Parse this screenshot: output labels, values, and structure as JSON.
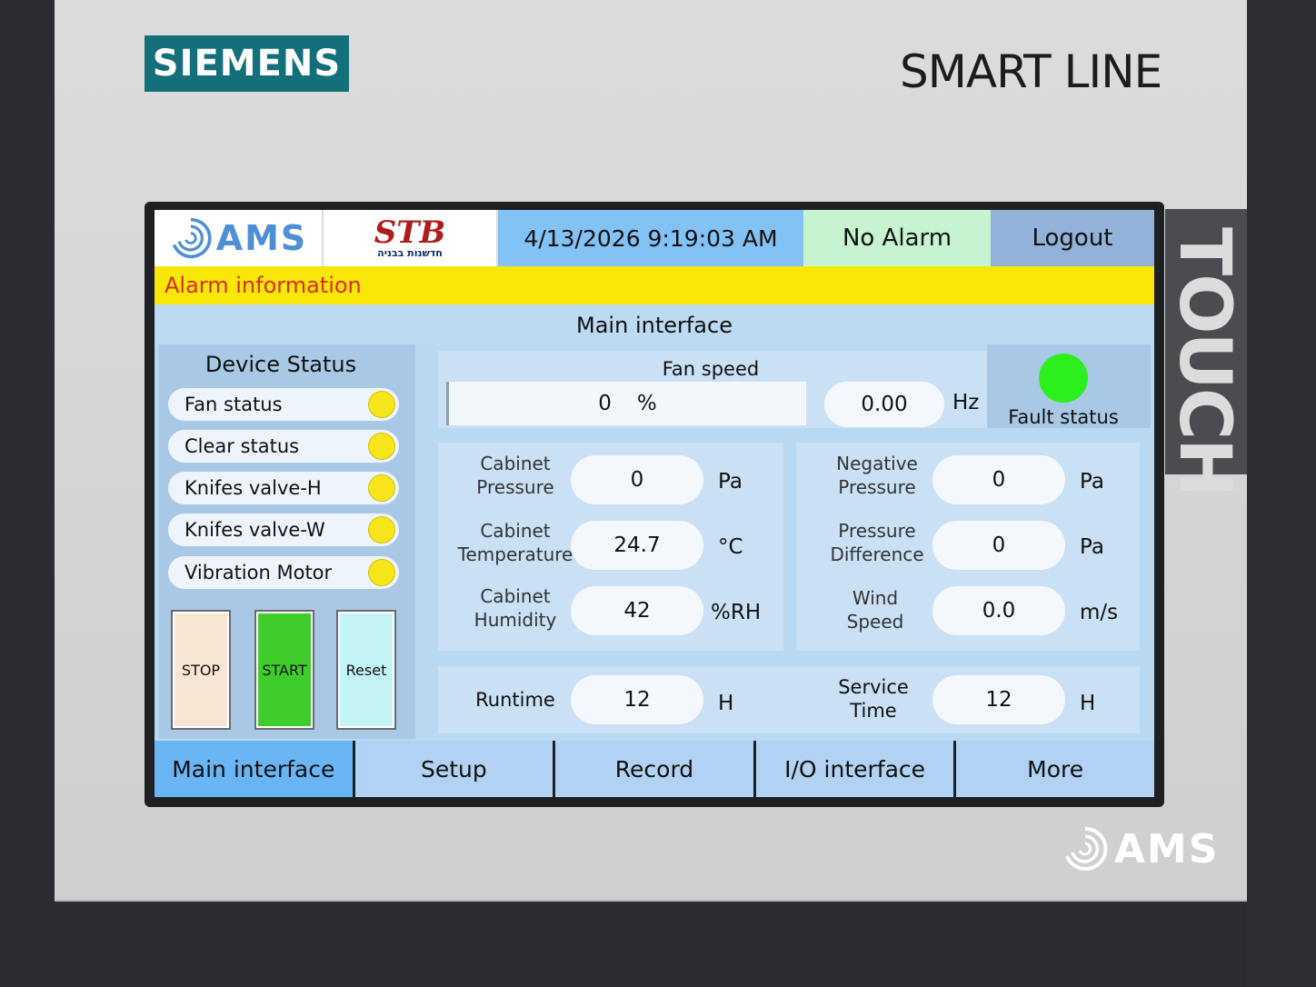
{
  "device": {
    "brand": "SIEMENS",
    "model": "SMART LINE",
    "side_label": "TOUCH",
    "bezel_logo": "AMS"
  },
  "header": {
    "ams_logo": "AMS",
    "stb_logo": "STB",
    "stb_subtitle": "חדשנות בבניה",
    "datetime": "4/13/2026 9:19:03 AM",
    "alarm_status": "No Alarm",
    "logout_label": "Logout"
  },
  "alarm_bar": {
    "text": "Alarm information"
  },
  "page_title": "Main interface",
  "device_status": {
    "title": "Device Status",
    "items": [
      {
        "label": "Fan status"
      },
      {
        "label": "Clear status"
      },
      {
        "label": "Knifes valve-H"
      },
      {
        "label": "Knifes valve-W"
      },
      {
        "label": "Vibration Motor"
      }
    ],
    "indicator_color": "#f6e51b"
  },
  "controls": {
    "stop": "STOP",
    "start": "START",
    "reset": "Reset"
  },
  "fan": {
    "title": "Fan speed",
    "percent_value": "0",
    "percent_unit": "%",
    "hz_value": "0.00",
    "hz_unit": "Hz"
  },
  "fault": {
    "label": "Fault status",
    "color": "#2bf01e"
  },
  "cabinet": [
    {
      "label_1": "Cabinet",
      "label_2": "Pressure",
      "value": "0",
      "unit": "Pa"
    },
    {
      "label_1": "Cabinet",
      "label_2": "Temperature",
      "value": "24.7",
      "unit": "°C"
    },
    {
      "label_1": "Cabinet",
      "label_2": "Humidity",
      "value": "42",
      "unit": "%RH"
    }
  ],
  "environment": [
    {
      "label_1": "Negative",
      "label_2": "Pressure",
      "value": "0",
      "unit": "Pa"
    },
    {
      "label_1": "Pressure",
      "label_2": "Difference",
      "value": "0",
      "unit": "Pa"
    },
    {
      "label_1": "Wind",
      "label_2": "Speed",
      "value": "0.0",
      "unit": "m/s"
    }
  ],
  "runtime": {
    "runtime_label": "Runtime",
    "runtime_value": "12",
    "runtime_unit": "H",
    "service_label_1": "Service",
    "service_label_2": "Time",
    "service_value": "12",
    "service_unit": "H"
  },
  "tabs": [
    {
      "label": "Main interface",
      "active": true
    },
    {
      "label": "Setup",
      "active": false
    },
    {
      "label": "Record",
      "active": false
    },
    {
      "label": "I/O interface",
      "active": false
    },
    {
      "label": "More",
      "active": false
    }
  ]
}
